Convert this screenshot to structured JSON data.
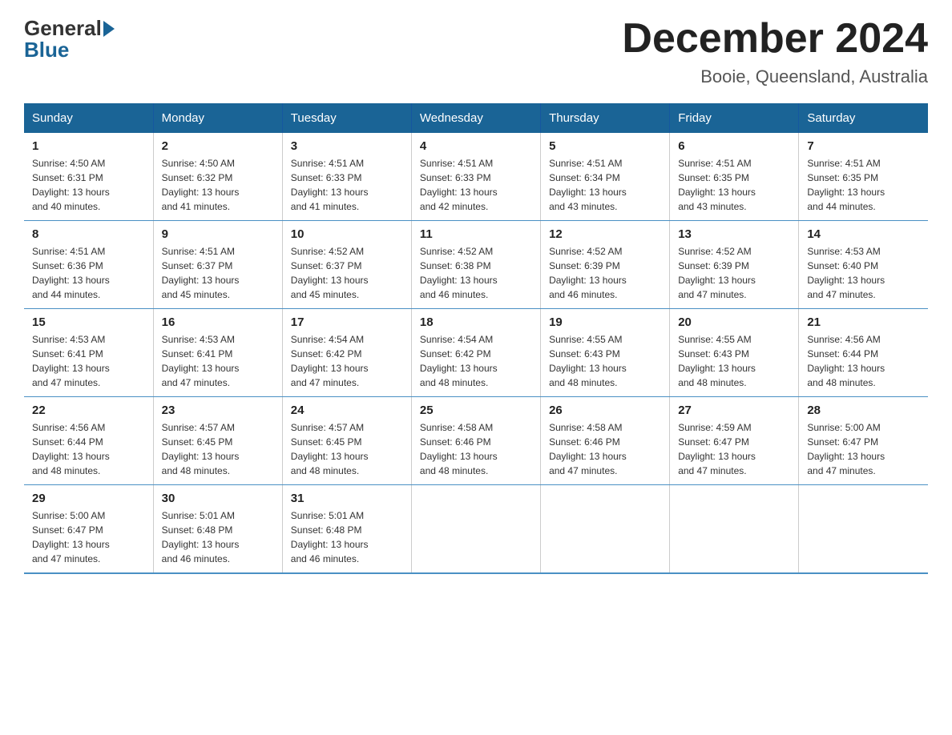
{
  "header": {
    "logo": {
      "part1": "General",
      "part2": "Blue"
    },
    "title": "December 2024",
    "location": "Booie, Queensland, Australia"
  },
  "days_of_week": [
    "Sunday",
    "Monday",
    "Tuesday",
    "Wednesday",
    "Thursday",
    "Friday",
    "Saturday"
  ],
  "weeks": [
    [
      {
        "day": "1",
        "sunrise": "4:50 AM",
        "sunset": "6:31 PM",
        "daylight": "13 hours and 40 minutes."
      },
      {
        "day": "2",
        "sunrise": "4:50 AM",
        "sunset": "6:32 PM",
        "daylight": "13 hours and 41 minutes."
      },
      {
        "day": "3",
        "sunrise": "4:51 AM",
        "sunset": "6:33 PM",
        "daylight": "13 hours and 41 minutes."
      },
      {
        "day": "4",
        "sunrise": "4:51 AM",
        "sunset": "6:33 PM",
        "daylight": "13 hours and 42 minutes."
      },
      {
        "day": "5",
        "sunrise": "4:51 AM",
        "sunset": "6:34 PM",
        "daylight": "13 hours and 43 minutes."
      },
      {
        "day": "6",
        "sunrise": "4:51 AM",
        "sunset": "6:35 PM",
        "daylight": "13 hours and 43 minutes."
      },
      {
        "day": "7",
        "sunrise": "4:51 AM",
        "sunset": "6:35 PM",
        "daylight": "13 hours and 44 minutes."
      }
    ],
    [
      {
        "day": "8",
        "sunrise": "4:51 AM",
        "sunset": "6:36 PM",
        "daylight": "13 hours and 44 minutes."
      },
      {
        "day": "9",
        "sunrise": "4:51 AM",
        "sunset": "6:37 PM",
        "daylight": "13 hours and 45 minutes."
      },
      {
        "day": "10",
        "sunrise": "4:52 AM",
        "sunset": "6:37 PM",
        "daylight": "13 hours and 45 minutes."
      },
      {
        "day": "11",
        "sunrise": "4:52 AM",
        "sunset": "6:38 PM",
        "daylight": "13 hours and 46 minutes."
      },
      {
        "day": "12",
        "sunrise": "4:52 AM",
        "sunset": "6:39 PM",
        "daylight": "13 hours and 46 minutes."
      },
      {
        "day": "13",
        "sunrise": "4:52 AM",
        "sunset": "6:39 PM",
        "daylight": "13 hours and 47 minutes."
      },
      {
        "day": "14",
        "sunrise": "4:53 AM",
        "sunset": "6:40 PM",
        "daylight": "13 hours and 47 minutes."
      }
    ],
    [
      {
        "day": "15",
        "sunrise": "4:53 AM",
        "sunset": "6:41 PM",
        "daylight": "13 hours and 47 minutes."
      },
      {
        "day": "16",
        "sunrise": "4:53 AM",
        "sunset": "6:41 PM",
        "daylight": "13 hours and 47 minutes."
      },
      {
        "day": "17",
        "sunrise": "4:54 AM",
        "sunset": "6:42 PM",
        "daylight": "13 hours and 47 minutes."
      },
      {
        "day": "18",
        "sunrise": "4:54 AM",
        "sunset": "6:42 PM",
        "daylight": "13 hours and 48 minutes."
      },
      {
        "day": "19",
        "sunrise": "4:55 AM",
        "sunset": "6:43 PM",
        "daylight": "13 hours and 48 minutes."
      },
      {
        "day": "20",
        "sunrise": "4:55 AM",
        "sunset": "6:43 PM",
        "daylight": "13 hours and 48 minutes."
      },
      {
        "day": "21",
        "sunrise": "4:56 AM",
        "sunset": "6:44 PM",
        "daylight": "13 hours and 48 minutes."
      }
    ],
    [
      {
        "day": "22",
        "sunrise": "4:56 AM",
        "sunset": "6:44 PM",
        "daylight": "13 hours and 48 minutes."
      },
      {
        "day": "23",
        "sunrise": "4:57 AM",
        "sunset": "6:45 PM",
        "daylight": "13 hours and 48 minutes."
      },
      {
        "day": "24",
        "sunrise": "4:57 AM",
        "sunset": "6:45 PM",
        "daylight": "13 hours and 48 minutes."
      },
      {
        "day": "25",
        "sunrise": "4:58 AM",
        "sunset": "6:46 PM",
        "daylight": "13 hours and 48 minutes."
      },
      {
        "day": "26",
        "sunrise": "4:58 AM",
        "sunset": "6:46 PM",
        "daylight": "13 hours and 47 minutes."
      },
      {
        "day": "27",
        "sunrise": "4:59 AM",
        "sunset": "6:47 PM",
        "daylight": "13 hours and 47 minutes."
      },
      {
        "day": "28",
        "sunrise": "5:00 AM",
        "sunset": "6:47 PM",
        "daylight": "13 hours and 47 minutes."
      }
    ],
    [
      {
        "day": "29",
        "sunrise": "5:00 AM",
        "sunset": "6:47 PM",
        "daylight": "13 hours and 47 minutes."
      },
      {
        "day": "30",
        "sunrise": "5:01 AM",
        "sunset": "6:48 PM",
        "daylight": "13 hours and 46 minutes."
      },
      {
        "day": "31",
        "sunrise": "5:01 AM",
        "sunset": "6:48 PM",
        "daylight": "13 hours and 46 minutes."
      },
      null,
      null,
      null,
      null
    ]
  ],
  "labels": {
    "sunrise": "Sunrise:",
    "sunset": "Sunset:",
    "daylight": "Daylight:"
  }
}
